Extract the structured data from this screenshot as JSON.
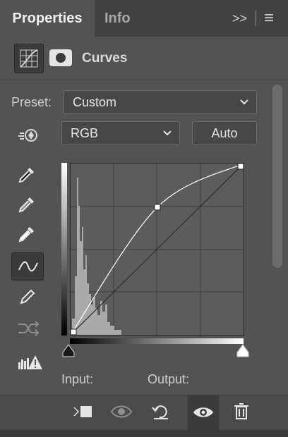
{
  "tabs": [
    {
      "label": "Properties",
      "active": true
    },
    {
      "label": "Info",
      "active": false
    }
  ],
  "tab_controls": {
    "expand": ">>",
    "menu": "≡"
  },
  "panel": {
    "title": "Curves",
    "icons": [
      "curves-adjustment-icon",
      "layer-mask-icon"
    ]
  },
  "preset": {
    "label": "Preset:",
    "value": "Custom"
  },
  "channel": {
    "value": "RGB"
  },
  "auto_button": "Auto",
  "tools": [
    "target-adjust-icon",
    "black-point-eyedropper-icon",
    "gray-point-eyedropper-icon",
    "white-point-eyedropper-icon",
    "curve-point-tool-icon",
    "pencil-icon",
    "smooth-curve-icon",
    "clipping-warning-icon"
  ],
  "curve": {
    "points": [
      [
        0,
        0
      ],
      [
        128,
        190
      ],
      [
        255,
        255
      ]
    ],
    "input_range": [
      0,
      255
    ],
    "output_range": [
      0,
      255
    ]
  },
  "io": {
    "input_label": "Input:",
    "output_label": "Output:"
  },
  "bottom_icons": [
    "clip-to-layer-icon",
    "view-previous-state-icon",
    "reset-icon",
    "visibility-eye-icon",
    "trash-icon"
  ],
  "colors": {
    "panel_bg": "#535353",
    "tab_bar": "#424242",
    "graph_bg": "#5c5c5c",
    "curve": "#ffffff"
  }
}
